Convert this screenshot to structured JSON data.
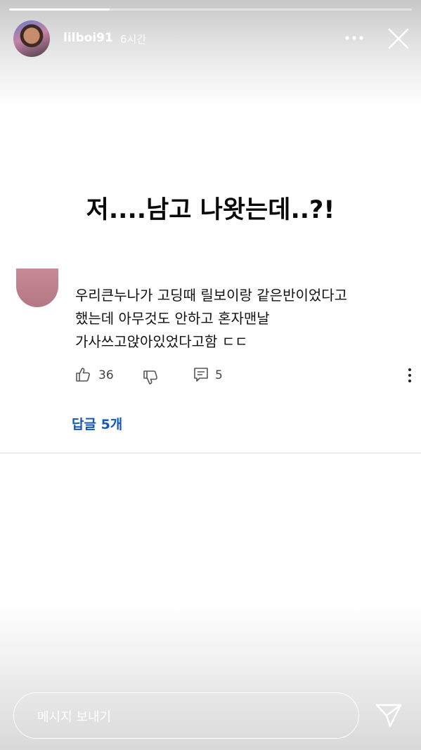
{
  "story": {
    "progress_fraction": 0.25,
    "username": "lilboi91",
    "time": "6시간",
    "headline": "저....남고 나왓는데..?!"
  },
  "comment": {
    "lines": [
      "우리큰누나가 고딩때 릴보이랑 같은반이었다고",
      "했는데 아무것도 안하고 혼자맨날",
      "가사쓰고앉아있었다고함 ㄷㄷ"
    ],
    "likes": "36",
    "replies_count": "5",
    "replies_link": "답글 5개"
  },
  "footer": {
    "message_placeholder": "메시지 보내기"
  },
  "colors": {
    "link": "#1558b8",
    "text": "#111111"
  }
}
